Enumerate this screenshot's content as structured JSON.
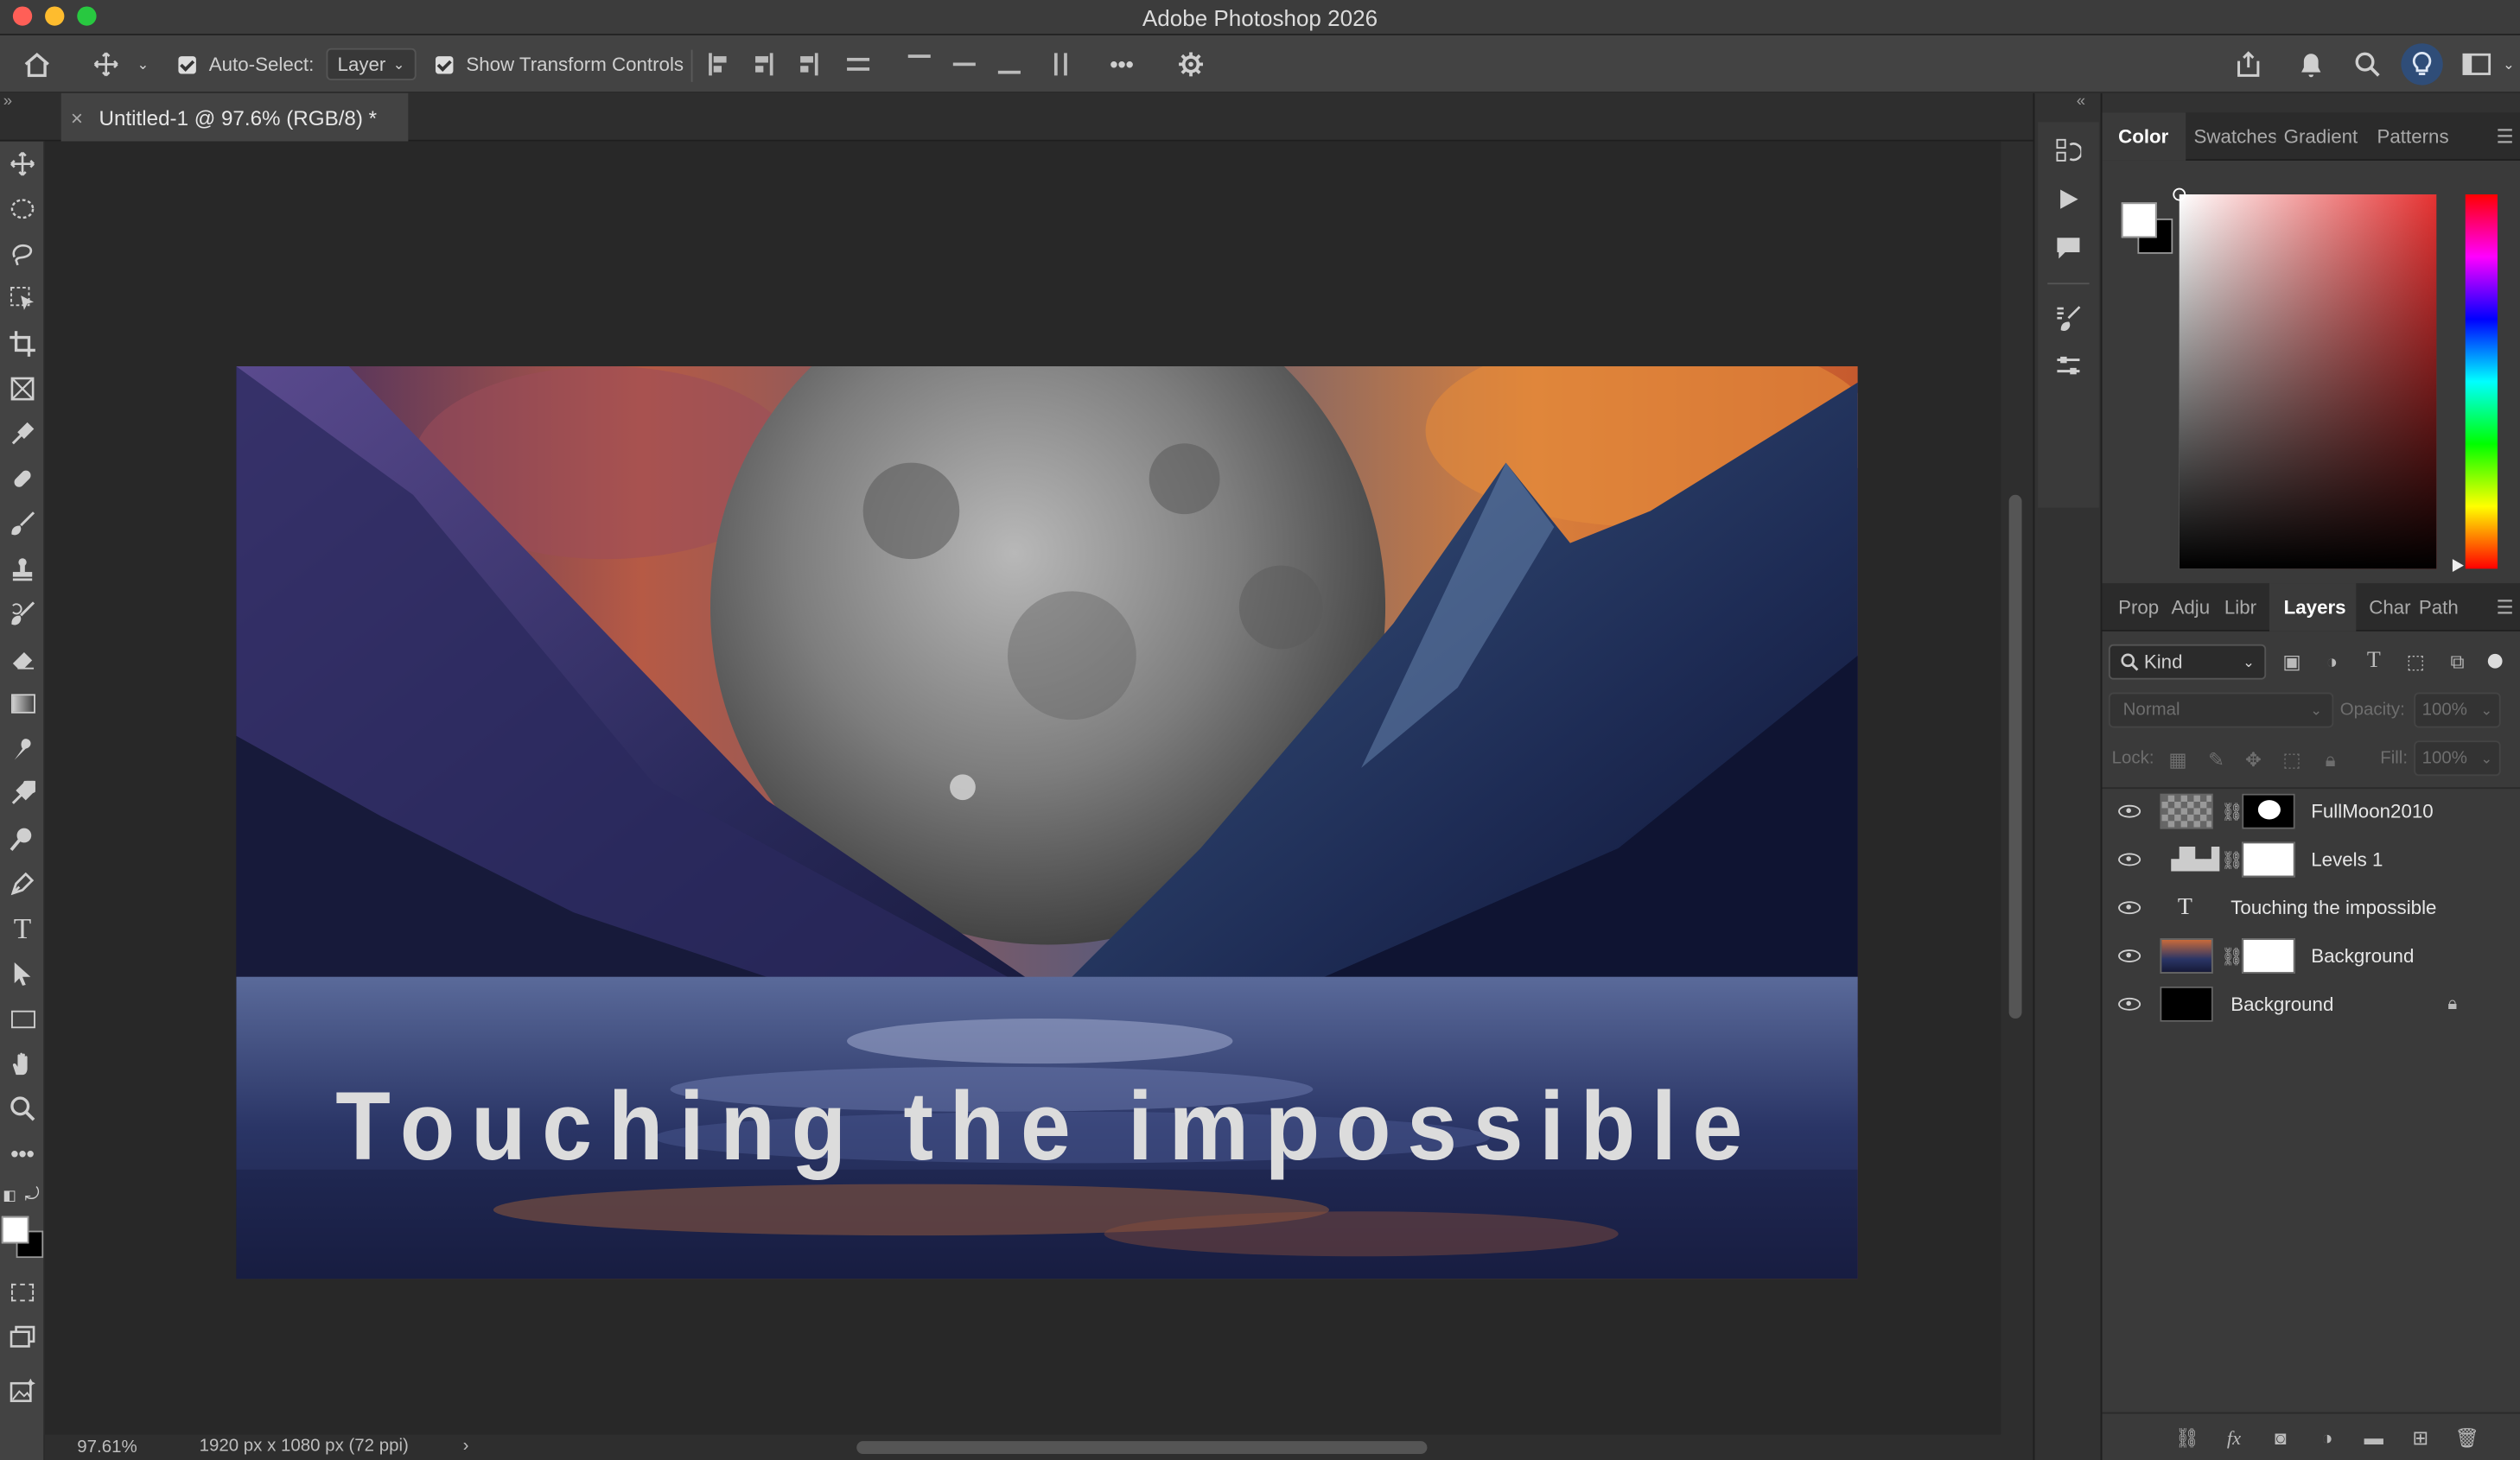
{
  "app": {
    "title": "Adobe Photoshop 2026"
  },
  "options_bar": {
    "auto_select_label": "Auto-Select:",
    "auto_select_value": "Layer",
    "show_transform_label": "Show Transform Controls",
    "more_label": "•••"
  },
  "document": {
    "tab_title": "Untitled-1 @ 97.6% (RGB/8) *",
    "close_glyph": "×",
    "canvas_text": "Touching the impossible"
  },
  "status": {
    "zoom": "97.61%",
    "dimensions": "1920 px x 1080 px (72 ppi)",
    "arrow": "›"
  },
  "color_panel": {
    "tabs": [
      "Color",
      "Swatches",
      "Gradient",
      "Patterns"
    ],
    "active_tab": "Color",
    "foreground": "#ffffff",
    "background": "#000000"
  },
  "layers_panel": {
    "tabs": [
      "Prop",
      "Adju",
      "Libr",
      "Layers",
      "Char",
      "Path"
    ],
    "active_tab": "Layers",
    "filter_label": "Kind",
    "blend_mode": "Normal",
    "opacity_label": "Opacity:",
    "opacity_value": "100%",
    "lock_label": "Lock:",
    "fill_label": "Fill:",
    "fill_value": "100%",
    "layers": [
      {
        "name": "FullMoon2010",
        "type": "smart-object-masked"
      },
      {
        "name": "Levels 1",
        "type": "adjustment"
      },
      {
        "name": "Touching the impossible",
        "type": "text"
      },
      {
        "name": "Background",
        "type": "image-masked"
      },
      {
        "name": "Background",
        "type": "background-locked"
      }
    ]
  },
  "icons": {
    "home": "home-icon",
    "move": "move-icon",
    "settings": "gear-icon",
    "share": "share-icon",
    "notifications": "bell-icon",
    "search": "search-icon",
    "discover": "lightbulb-icon",
    "workspace": "workspace-icon"
  }
}
